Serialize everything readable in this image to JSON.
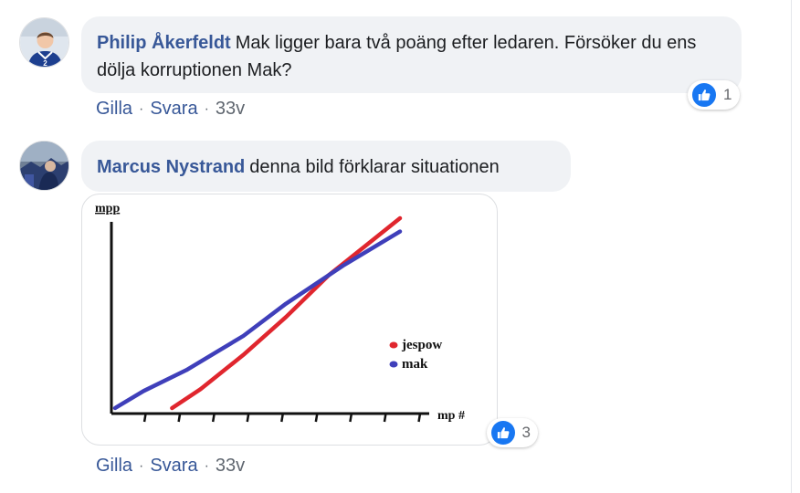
{
  "comments": [
    {
      "author": "Philip Åkerfeldt",
      "text": "Mak ligger bara två poäng efter ledaren. Försöker du ens dölja korruptionen Mak?",
      "reaction_count": "1",
      "actions": {
        "like": "Gilla",
        "reply": "Svara",
        "time": "33v"
      },
      "avatar_icon": "player-avatar",
      "jersey_number": "2"
    },
    {
      "author": "Marcus Nystrand",
      "text": "denna bild förklarar situationen",
      "reaction_count": "3",
      "actions": {
        "like": "Gilla",
        "reply": "Svara",
        "time": "33v"
      },
      "avatar_icon": "user-avatar"
    }
  ],
  "colors": {
    "link": "#385898",
    "bubble": "#f0f2f5",
    "like": "#1877f2",
    "series_red": "#e0262e",
    "series_blue": "#3f3fba"
  },
  "chart_data": {
    "type": "line",
    "ylabel": "mpp",
    "xlabel": "mp #",
    "ticks": "unlabeled",
    "legend_position": "right",
    "grid": false,
    "series": [
      {
        "name": "jespow",
        "color": "#e0262e",
        "x": [
          0.2,
          0.3,
          0.45,
          0.6,
          0.75,
          0.9,
          1.0
        ],
        "y": [
          0.0,
          0.1,
          0.28,
          0.48,
          0.7,
          0.88,
          1.0
        ]
      },
      {
        "name": "mak",
        "color": "#3f3fba",
        "x": [
          0.0,
          0.1,
          0.25,
          0.45,
          0.6,
          0.8,
          1.0
        ],
        "y": [
          0.0,
          0.09,
          0.2,
          0.38,
          0.55,
          0.75,
          0.93
        ]
      }
    ],
    "xlim": [
      0,
      1
    ],
    "ylim": [
      0,
      1
    ]
  }
}
